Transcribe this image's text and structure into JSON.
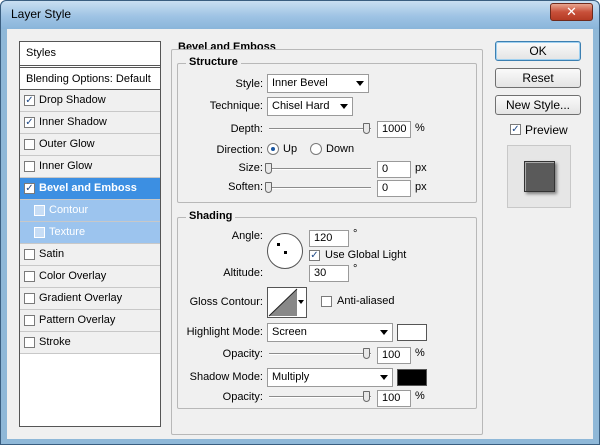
{
  "window": {
    "title": "Layer Style",
    "close_glyph": "✕"
  },
  "sidebar": {
    "header": "Styles",
    "blending": "Blending Options: Default",
    "items": [
      {
        "label": "Drop Shadow",
        "checked": true
      },
      {
        "label": "Inner Shadow",
        "checked": true
      },
      {
        "label": "Outer Glow",
        "checked": false
      },
      {
        "label": "Inner Glow",
        "checked": false
      },
      {
        "label": "Bevel and Emboss",
        "checked": true,
        "active": true
      },
      {
        "label": "Contour",
        "checked": false,
        "sub": true
      },
      {
        "label": "Texture",
        "checked": false,
        "sub": true
      },
      {
        "label": "Satin",
        "checked": false
      },
      {
        "label": "Color Overlay",
        "checked": false
      },
      {
        "label": "Gradient Overlay",
        "checked": false
      },
      {
        "label": "Pattern Overlay",
        "checked": false
      },
      {
        "label": "Stroke",
        "checked": false
      }
    ]
  },
  "bevel": {
    "group_title": "Bevel and Emboss",
    "structure": {
      "title": "Structure",
      "style_label": "Style:",
      "style_value": "Inner Bevel",
      "technique_label": "Technique:",
      "technique_value": "Chisel Hard",
      "depth_label": "Depth:",
      "depth_value": "1000",
      "depth_unit": "%",
      "direction_label": "Direction:",
      "direction_up": "Up",
      "direction_down": "Down",
      "size_label": "Size:",
      "size_value": "0",
      "size_unit": "px",
      "soften_label": "Soften:",
      "soften_value": "0",
      "soften_unit": "px"
    },
    "shading": {
      "title": "Shading",
      "angle_label": "Angle:",
      "angle_value": "120",
      "angle_unit": "°",
      "global_light_label": "Use Global Light",
      "altitude_label": "Altitude:",
      "altitude_value": "30",
      "altitude_unit": "°",
      "gloss_label": "Gloss Contour:",
      "anti_aliased_label": "Anti-aliased",
      "highlight_label": "Highlight Mode:",
      "highlight_value": "Screen",
      "highlight_color": "#ffffff",
      "highlight_opacity_label": "Opacity:",
      "highlight_opacity_value": "100",
      "highlight_opacity_unit": "%",
      "shadow_label": "Shadow Mode:",
      "shadow_value": "Multiply",
      "shadow_color": "#000000",
      "shadow_opacity_label": "Opacity:",
      "shadow_opacity_value": "100",
      "shadow_opacity_unit": "%"
    }
  },
  "buttons": {
    "ok": "OK",
    "reset": "Reset",
    "new_style": "New Style...",
    "preview": "Preview"
  }
}
